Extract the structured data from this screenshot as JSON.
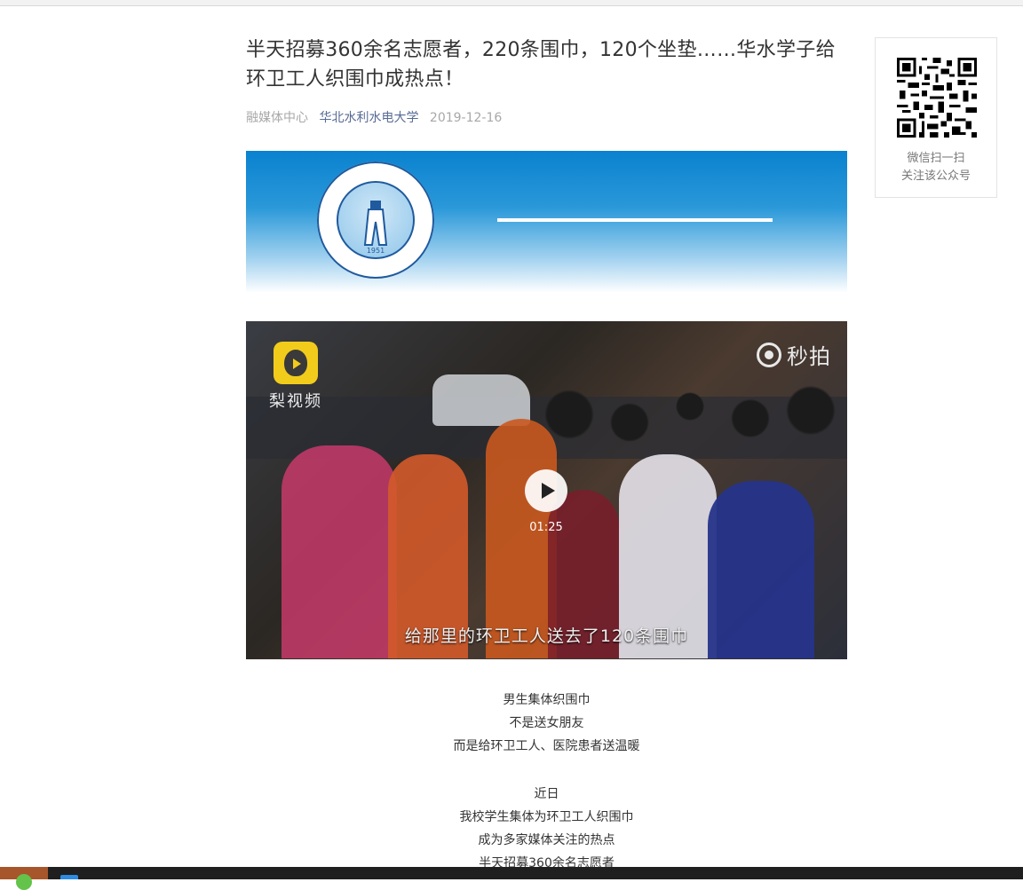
{
  "article": {
    "title": "半天招募360余名志愿者，220条围巾，120个坐垫……华水学子给环卫工人织围巾成热点！",
    "source": "融媒体中心",
    "account": "华北水利水电大学",
    "date": "2019-12-16"
  },
  "banner": {
    "logo_year": "1951"
  },
  "video": {
    "watermark_left": "梨视频",
    "watermark_right": "秒拍",
    "duration": "01:25",
    "subtitle": "给那里的环卫工人送去了120条围巾"
  },
  "body": {
    "para1": [
      "男生集体织围巾",
      "不是送女朋友",
      "而是给环卫工人、医院患者送温暖"
    ],
    "para2": [
      "近日",
      "我校学生集体为环卫工人织围巾",
      "成为多家媒体关注的热点",
      "半天招募360余名志愿者"
    ]
  },
  "qr": {
    "line1": "微信扫一扫",
    "line2": "关注该公众号"
  },
  "colors": {
    "account_link": "#576b95",
    "banner_blue": "#0a82cf",
    "pear_yellow": "#f2cc1b"
  }
}
